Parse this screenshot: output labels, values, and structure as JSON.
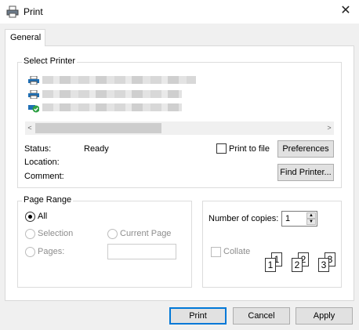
{
  "window": {
    "title": "Print",
    "close_icon": "close-icon"
  },
  "tab": {
    "label": "General"
  },
  "select_printer": {
    "legend": "Select Printer",
    "printers": [
      {
        "icon": "printer-icon",
        "name_hidden": true
      },
      {
        "icon": "printer-icon",
        "name_hidden": true
      },
      {
        "icon": "printer-default-icon",
        "name_hidden": true
      }
    ],
    "status_label": "Status:",
    "status_value": "Ready",
    "location_label": "Location:",
    "comment_label": "Comment:",
    "print_to_file_label": "Print to file",
    "preferences_label": "Preferences",
    "find_printer_label": "Find Printer..."
  },
  "page_range": {
    "legend": "Page Range",
    "all_label": "All",
    "selection_label": "Selection",
    "current_page_label": "Current Page",
    "pages_label": "Pages:",
    "pages_value": ""
  },
  "copies": {
    "number_label": "Number of copies:",
    "number_value": "1",
    "collate_label": "Collate"
  },
  "buttons": {
    "print": "Print",
    "cancel": "Cancel",
    "apply": "Apply"
  },
  "colors": {
    "accent": "#0078d7",
    "check": "#2ea043"
  }
}
